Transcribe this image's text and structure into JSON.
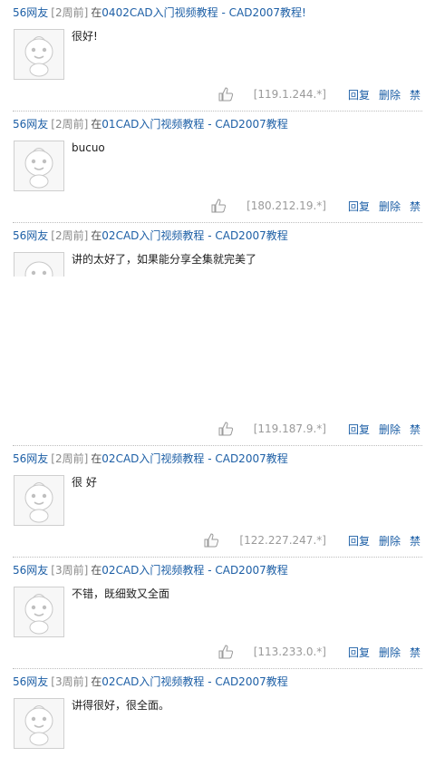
{
  "comments": [
    {
      "user": "56网友",
      "when": "[2周前]",
      "in_label": "在",
      "video": "0402CAD入门视频教程 - CAD2007教程!",
      "text": "很好!",
      "ip": "[119.1.244.*]",
      "reply_label": "回复",
      "delete_label": "删除",
      "ban_label": "禁"
    },
    {
      "user": "56网友",
      "when": "[2周前]",
      "in_label": "在",
      "video": "01CAD入门视频教程 - CAD2007教程",
      "text": "bucuo",
      "ip": "[180.212.19.*]",
      "reply_label": "回复",
      "delete_label": "删除",
      "ban_label": "禁"
    },
    {
      "user": "56网友",
      "when": "[2周前]",
      "in_label": "在",
      "video": "02CAD入门视频教程 - CAD2007教程",
      "text": "讲的太好了，如果能分享全集就完美了",
      "ip": "[119.187.9.*]",
      "reply_label": "回复",
      "delete_label": "删除",
      "ban_label": "禁"
    },
    {
      "user": "56网友",
      "when": "[2周前]",
      "in_label": "在",
      "video": "02CAD入门视频教程 - CAD2007教程",
      "text": "很 好",
      "ip": "[122.227.247.*]",
      "reply_label": "回复",
      "delete_label": "删除",
      "ban_label": "禁"
    },
    {
      "user": "56网友",
      "when": "[3周前]",
      "in_label": "在",
      "video": "02CAD入门视频教程 - CAD2007教程",
      "text": "不错，既细致又全面",
      "ip": "[113.233.0.*]",
      "reply_label": "回复",
      "delete_label": "删除",
      "ban_label": "禁"
    },
    {
      "user": "56网友",
      "when": "[3周前]",
      "in_label": "在",
      "video": "02CAD入门视频教程 - CAD2007教程",
      "text": "讲得很好，很全面。",
      "ip": "",
      "reply_label": "",
      "delete_label": "",
      "ban_label": ""
    }
  ]
}
